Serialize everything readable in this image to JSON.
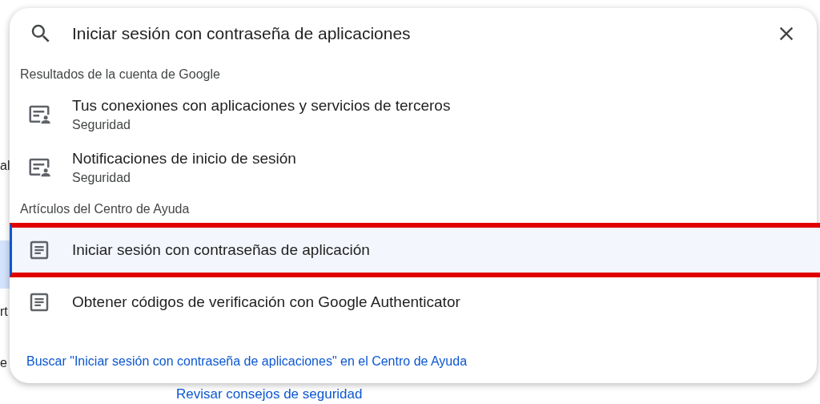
{
  "background": {
    "fragments": [
      "al",
      "rt",
      "e"
    ],
    "link": "Revisar consejos de seguridad"
  },
  "search": {
    "value": "Iniciar sesión con contraseña de aplicaciones"
  },
  "sections": [
    {
      "heading": "Resultados de la cuenta de Google",
      "results": [
        {
          "kind": "account",
          "title": "Tus conexiones con aplicaciones y servicios de terceros",
          "subtitle": "Seguridad",
          "selected": false
        },
        {
          "kind": "account",
          "title": "Notificaciones de inicio de sesión",
          "subtitle": "Seguridad",
          "selected": false
        }
      ]
    },
    {
      "heading": "Artículos del Centro de Ayuda",
      "results": [
        {
          "kind": "article",
          "title": "Iniciar sesión con contraseñas de aplicación",
          "selected": true
        },
        {
          "kind": "article",
          "title": "Obtener códigos de verificación con Google Authenticator",
          "selected": false
        }
      ]
    }
  ],
  "help_search_link": "Buscar \"Iniciar sesión con contraseña de aplicaciones\" en el Centro de Ayuda"
}
